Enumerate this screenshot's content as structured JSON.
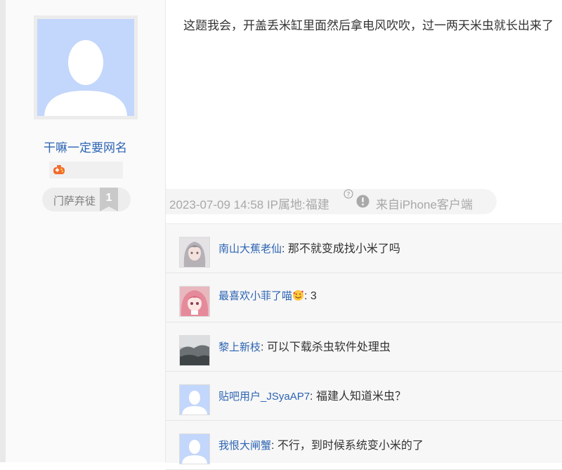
{
  "post": {
    "text": "这题我会，开盖丢米缸里面然后拿电风吹吹，过一两天米虫就长出来了",
    "date_location": "2023-07-09 14:58 IP属地:福建",
    "client": "来自iPhone客户端"
  },
  "author": {
    "username": "干嘛一定要网名",
    "level_name": "门萨弃徒",
    "level_num": "1",
    "badge_icon": "game-controller-icon"
  },
  "colors": {
    "link": "#2d64b3",
    "avatar_default": "#c3d6fb"
  },
  "comments": [
    {
      "name": "南山大蕉老仙",
      "sep": ": ",
      "text": "那不就变成找小米了吗",
      "avatar": "anime-girl-gray-avatar"
    },
    {
      "name": "最喜欢小菲了喵",
      "sep": ": ",
      "text": "3",
      "avatar": "anime-girl-pink-avatar",
      "emoji": "smiling-face-with-hearts-emoji"
    },
    {
      "name": "黎上新枝",
      "sep": ": ",
      "text": "可以下载杀虫软件处理虫",
      "avatar": "misty-landscape-avatar"
    },
    {
      "name": "贴吧用户_JSyaAP7",
      "sep": ": ",
      "text": "福建人知道米虫？",
      "avatar": "default-avatar"
    },
    {
      "name": "我恨大闸蟹",
      "sep": ": ",
      "text": "不行，到时候系统变小米的了",
      "avatar": "default-avatar"
    }
  ]
}
